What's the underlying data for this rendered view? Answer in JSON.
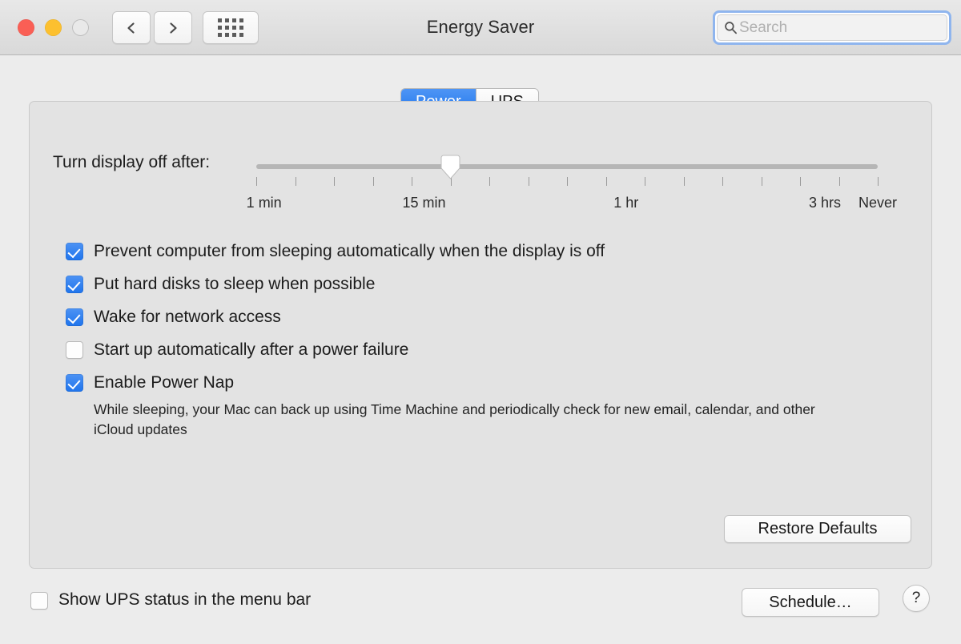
{
  "window": {
    "title": "Energy Saver",
    "traffic_lights": [
      "close",
      "minimize",
      "zoom"
    ],
    "nav": {
      "back_icon": "chevron-left-icon",
      "forward_icon": "chevron-right-icon",
      "grid_icon": "show-all-grid-icon"
    }
  },
  "search": {
    "placeholder": "Search",
    "value": "",
    "icon": "search-icon",
    "focused": true,
    "focus_ring_color": "#8fb5ee"
  },
  "tabs": [
    {
      "label": "Power",
      "active": true
    },
    {
      "label": "UPS",
      "active": false
    }
  ],
  "slider": {
    "label": "Turn display off after:",
    "tick_count": 17,
    "thumb_index": 5,
    "tick_labels": [
      {
        "text": "1 min",
        "pos": 0.0125
      },
      {
        "text": "15 min",
        "pos": 0.27
      },
      {
        "text": "1 hr",
        "pos": 0.595
      },
      {
        "text": "3 hrs",
        "pos": 0.915
      },
      {
        "text": "Never",
        "pos": 1.0
      }
    ]
  },
  "checkboxes": [
    {
      "label": "Prevent computer from sleeping automatically when the display is off",
      "checked": true
    },
    {
      "label": "Put hard disks to sleep when possible",
      "checked": true
    },
    {
      "label": "Wake for network access",
      "checked": true
    },
    {
      "label": "Start up automatically after a power failure",
      "checked": false
    },
    {
      "label": "Enable Power Nap",
      "checked": true
    }
  ],
  "power_nap_description": "While sleeping, your Mac can back up using Time Machine and periodically check for new email, calendar, and other iCloud updates",
  "buttons": {
    "restore_defaults": "Restore Defaults",
    "schedule": "Schedule…",
    "help": "?"
  },
  "bottom_checkbox": {
    "label": "Show UPS status in the menu bar",
    "checked": false
  },
  "colors": {
    "accent": "#2176ec",
    "window_bg": "#ececec",
    "panel_bg": "#e3e3e3",
    "text": "#1c1c1c"
  }
}
